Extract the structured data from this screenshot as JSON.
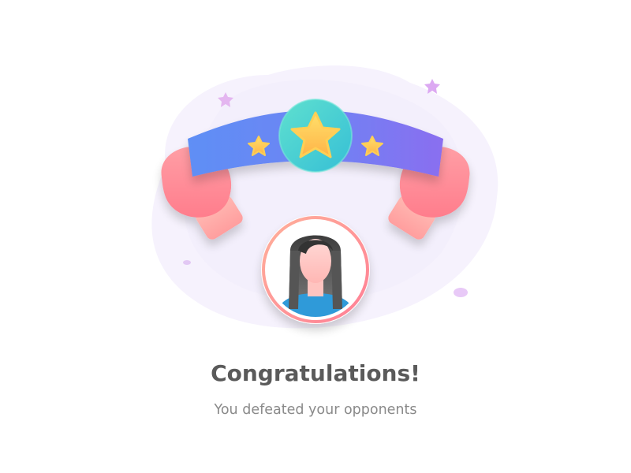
{
  "screen": {
    "title": "Congratulations!",
    "message": "You defeated your opponents"
  },
  "illustration": {
    "belt_star_count": 3,
    "icons": [
      "championship-belt-icon",
      "boxing-glove-icon",
      "star-icon",
      "sparkle-icon",
      "user-avatar-icon"
    ]
  },
  "colors": {
    "title": "#5a5a5a",
    "message": "#8a8a8a",
    "belt_blue": "#5a8ef5",
    "belt_purple": "#8d6ef0",
    "medallion_teal": "#48d6c2",
    "star_gold": "#ffcb45",
    "glove_pink": "#ff8c96",
    "avatar_ring": "#ff9a8a",
    "avatar_shirt": "#2f9ad9",
    "backdrop": "#f6f2fd"
  }
}
